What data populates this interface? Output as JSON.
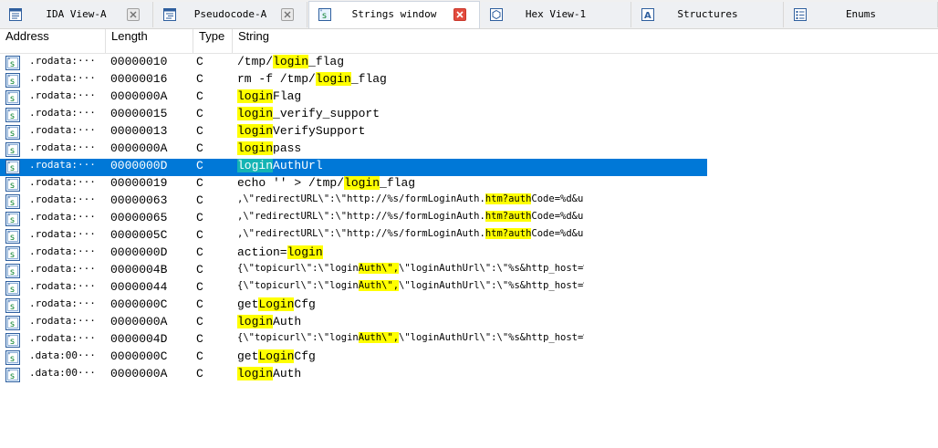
{
  "tabs": [
    {
      "label": "IDA View-A",
      "icon": "ida-view-icon"
    },
    {
      "label": "Pseudocode-A",
      "icon": "pseudocode-icon"
    },
    {
      "label": "Strings window",
      "icon": "strings-icon",
      "active": true
    },
    {
      "label": "Hex View-1",
      "icon": "hex-view-icon"
    },
    {
      "label": "Structures",
      "icon": "structures-icon"
    },
    {
      "label": "Enums",
      "icon": "enums-icon"
    }
  ],
  "columns": {
    "address": "Address",
    "length": "Length",
    "type": "Type",
    "string": "String"
  },
  "colors": {
    "selection": "#0078d7",
    "highlight": "#ffff00",
    "selected_highlight": "#14b4b4"
  },
  "rows": [
    {
      "address": ".rodata:···",
      "length": "00000010",
      "type": "C",
      "segments": [
        "/tmp/",
        "login",
        "_flag"
      ]
    },
    {
      "address": ".rodata:···",
      "length": "00000016",
      "type": "C",
      "segments": [
        "rm -f /tmp/",
        "login",
        "_flag"
      ]
    },
    {
      "address": ".rodata:···",
      "length": "0000000A",
      "type": "C",
      "segments": [
        "",
        "login",
        "Flag"
      ]
    },
    {
      "address": ".rodata:···",
      "length": "00000015",
      "type": "C",
      "segments": [
        "",
        "login",
        "_verify_support"
      ]
    },
    {
      "address": ".rodata:···",
      "length": "00000013",
      "type": "C",
      "segments": [
        "",
        "login",
        "VerifySupport"
      ]
    },
    {
      "address": ".rodata:···",
      "length": "0000000A",
      "type": "C",
      "segments": [
        "",
        "login",
        "pass"
      ]
    },
    {
      "address": ".rodata:···",
      "length": "0000000D",
      "type": "C",
      "segments": [
        "",
        "login",
        "AuthUrl"
      ],
      "selected": true
    },
    {
      "address": ".rodata:···",
      "length": "00000019",
      "type": "C",
      "segments": [
        "echo '' > /tmp/",
        "login",
        "_flag"
      ]
    },
    {
      "address": ".rodata:···",
      "length": "00000063",
      "type": "C",
      "small": true,
      "segments": [
        ",\\\"redirectURL\\\":\\\"http://%s/formLoginAuth.",
        "htm?auth",
        "Code=%d&us···"
      ]
    },
    {
      "address": ".rodata:···",
      "length": "00000065",
      "type": "C",
      "small": true,
      "segments": [
        ",\\\"redirectURL\\\":\\\"http://%s/formLoginAuth.",
        "htm?auth",
        "Code=%d&us···"
      ]
    },
    {
      "address": ".rodata:···",
      "length": "0000005C",
      "type": "C",
      "small": true,
      "segments": [
        ",\\\"redirectURL\\\":\\\"http://%s/formLoginAuth.",
        "htm?auth",
        "Code=%d&us···"
      ]
    },
    {
      "address": ".rodata:···",
      "length": "0000000D",
      "type": "C",
      "segments": [
        "action=",
        "login",
        ""
      ]
    },
    {
      "address": ".rodata:···",
      "length": "0000004B",
      "type": "C",
      "small": true,
      "segments": [
        "{\\\"topicurl\\\":\\\"login",
        "Auth\\\",",
        "\\\"loginAuthUrl\\\":\\\"%s&http_host=%···"
      ]
    },
    {
      "address": ".rodata:···",
      "length": "00000044",
      "type": "C",
      "small": true,
      "segments": [
        "{\\\"topicurl\\\":\\\"login",
        "Auth\\\",",
        "\\\"loginAuthUrl\\\":\\\"%s&http_host=%···"
      ]
    },
    {
      "address": ".rodata:···",
      "length": "0000000C",
      "type": "C",
      "segments": [
        "get",
        "Login",
        "Cfg"
      ]
    },
    {
      "address": ".rodata:···",
      "length": "0000000A",
      "type": "C",
      "segments": [
        "",
        "login",
        "Auth"
      ]
    },
    {
      "address": ".rodata:···",
      "length": "0000004D",
      "type": "C",
      "small": true,
      "segments": [
        "{\\\"topicurl\\\":\\\"login",
        "Auth\\\",",
        "\\\"loginAuthUrl\\\":\\\"%s&http_host=%···"
      ]
    },
    {
      "address": ".data:00···",
      "length": "0000000C",
      "type": "C",
      "segments": [
        "get",
        "Login",
        "Cfg"
      ]
    },
    {
      "address": ".data:00···",
      "length": "0000000A",
      "type": "C",
      "segments": [
        "",
        "login",
        "Auth"
      ]
    }
  ]
}
